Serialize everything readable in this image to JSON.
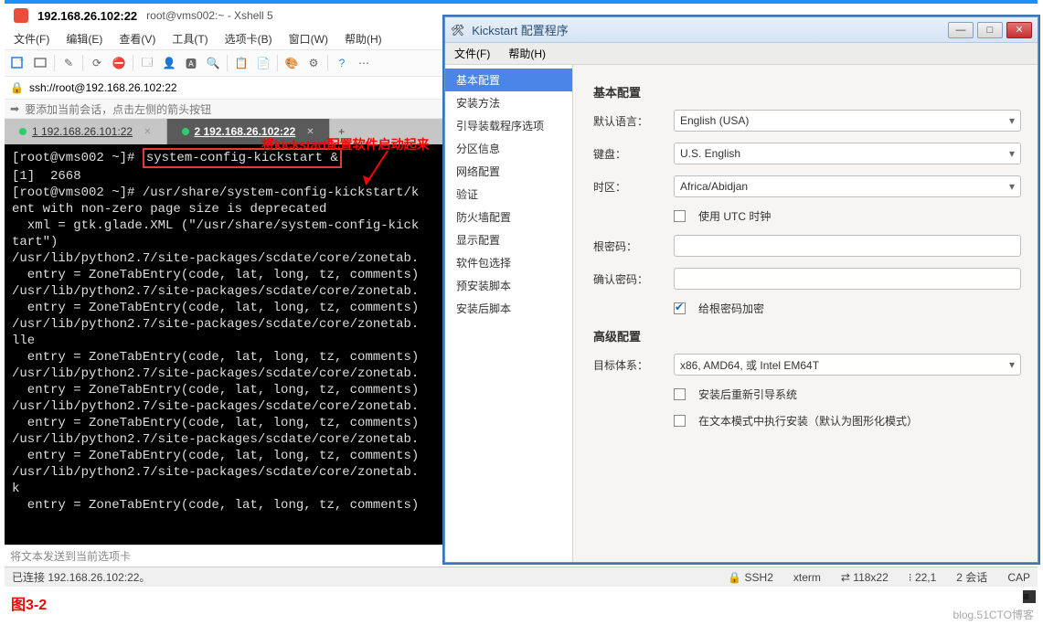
{
  "xshell": {
    "title": "192.168.26.102:22",
    "subtitle": "root@vms002:~ - Xshell 5",
    "menu": [
      "文件(F)",
      "编辑(E)",
      "查看(V)",
      "工具(T)",
      "选项卡(B)",
      "窗口(W)",
      "帮助(H)"
    ],
    "address": "ssh://root@192.168.26.102:22",
    "hint": "要添加当前会话，点击左侧的箭头按钮",
    "tabs": [
      {
        "label": "1 192.168.26.101:22",
        "active": false
      },
      {
        "label": "2 192.168.26.102:22",
        "active": true
      }
    ],
    "prompt1": "[root@vms002 ~]# ",
    "command": "system-config-kickstart &",
    "terminal_rest": "[1]  2668\n[root@vms002 ~]# /usr/share/system-config-kickstart/k\nent with non-zero page size is deprecated\n  xml = gtk.glade.XML (\"/usr/share/system-config-kick\ntart\")\n/usr/lib/python2.7/site-packages/scdate/core/zonetab.\n  entry = ZoneTabEntry(code, lat, long, tz, comments)\n/usr/lib/python2.7/site-packages/scdate/core/zonetab.\n  entry = ZoneTabEntry(code, lat, long, tz, comments)\n/usr/lib/python2.7/site-packages/scdate/core/zonetab.\nlle\n  entry = ZoneTabEntry(code, lat, long, tz, comments)\n/usr/lib/python2.7/site-packages/scdate/core/zonetab.\n  entry = ZoneTabEntry(code, lat, long, tz, comments)\n/usr/lib/python2.7/site-packages/scdate/core/zonetab.\n  entry = ZoneTabEntry(code, lat, long, tz, comments)\n/usr/lib/python2.7/site-packages/scdate/core/zonetab.\n  entry = ZoneTabEntry(code, lat, long, tz, comments)\n/usr/lib/python2.7/site-packages/scdate/core/zonetab.\nk\n  entry = ZoneTabEntry(code, lat, long, tz, comments)",
    "send_hint": "将文本发送到当前选项卡",
    "status_left": "已连接 192.168.26.102:22。",
    "status_right": {
      "ssh": "SSH2",
      "term": "xterm",
      "size": "118x22",
      "pos": "22,1",
      "sess": "2 会话",
      "cap": "CAP"
    }
  },
  "annotation": {
    "text": "将kickstart配置软件启动起来",
    "figure": "图3-2"
  },
  "ks": {
    "title": "Kickstart 配置程序",
    "menu": [
      "文件(F)",
      "帮助(H)"
    ],
    "side": [
      "基本配置",
      "安装方法",
      "引导装载程序选项",
      "分区信息",
      "网络配置",
      "验证",
      "防火墙配置",
      "显示配置",
      "软件包选择",
      "预安装脚本",
      "安装后脚本"
    ],
    "basic": {
      "heading": "基本配置",
      "lang_label": "默认语言：",
      "lang_value": "English (USA)",
      "kb_label": "键盘：",
      "kb_value": "U.S. English",
      "tz_label": "时区：",
      "tz_value": "Africa/Abidjan",
      "utc_label": "使用  UTC 时钟",
      "root_label": "根密码：",
      "confirm_label": "确认密码：",
      "encrypt_label": "给根密码加密"
    },
    "adv": {
      "heading": "高级配置",
      "arch_label": "目标体系：",
      "arch_value": "x86, AMD64, 或 Intel EM64T",
      "reboot_label": "安装后重新引导系统",
      "textmode_label": "在文本模式中执行安装（默认为图形化模式）"
    }
  },
  "watermark": "blog.51CTO博客"
}
